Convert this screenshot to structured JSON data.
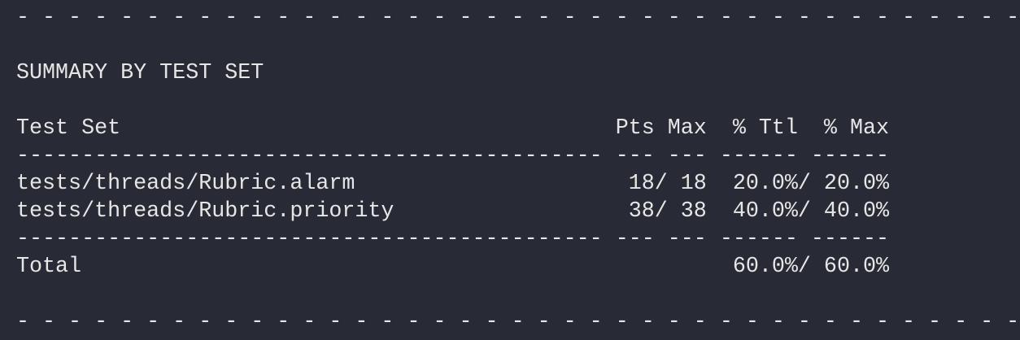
{
  "terminal": {
    "separator_top": "- - - - - - - - - - - - - - - - - - - - - - - - - - - - - - - - - - - - - - - -",
    "heading": "SUMMARY BY TEST SET",
    "table_header": "Test Set                                      Pts Max  % Ttl  % Max",
    "rule": "--------------------------------------------- --- --- ------ ------",
    "rows": [
      "tests/threads/Rubric.alarm                     18/ 18  20.0%/ 20.0%",
      "tests/threads/Rubric.priority                  38/ 38  40.0%/ 40.0%"
    ],
    "total": "Total                                                  60.0%/ 60.0%",
    "separator_bottom": "- - - - - - - - - - - - - - - - - - - - - - - - - - - - - - - - - - - - - - - -"
  }
}
